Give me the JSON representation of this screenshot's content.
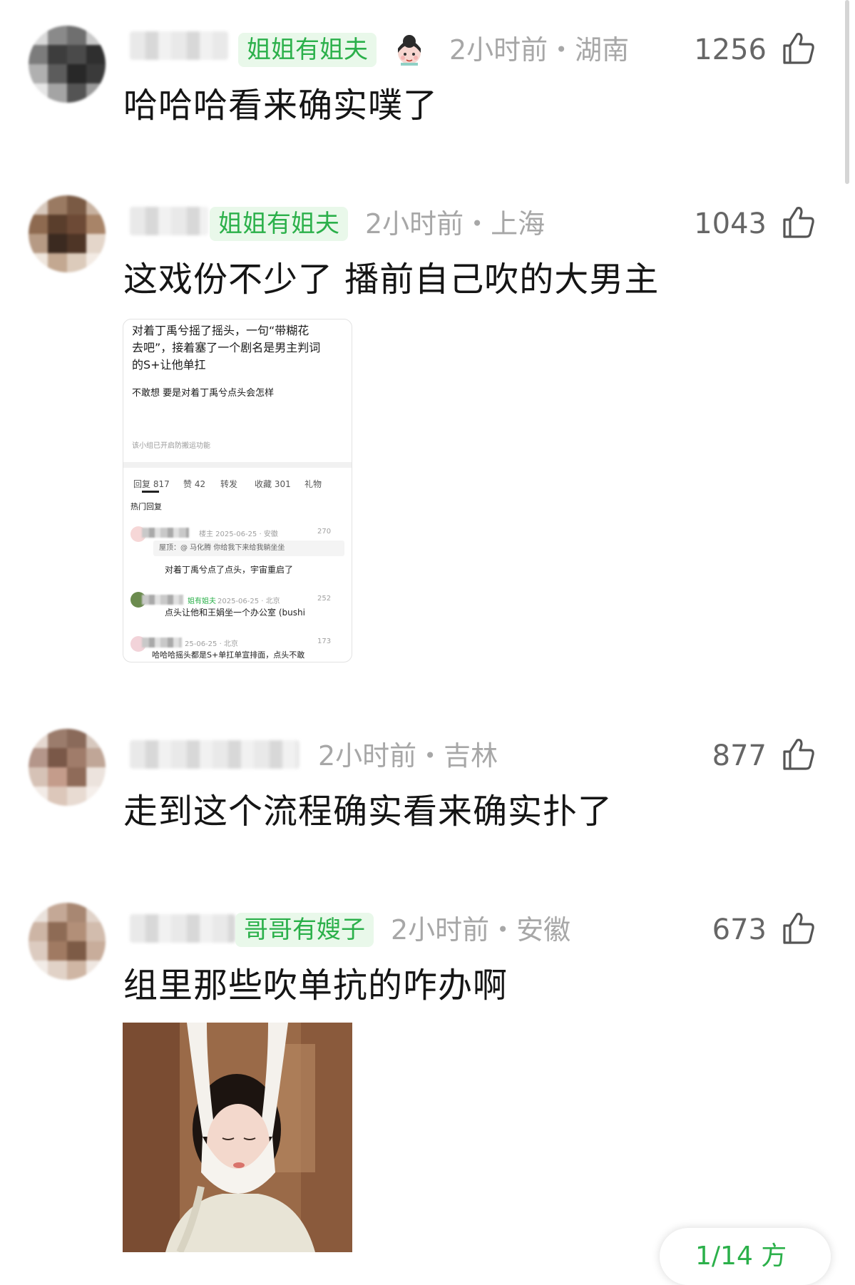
{
  "colors": {
    "badge_text": "#2bb04a",
    "badge_bg": "#e9f8ea",
    "meta_text": "#a7a7a7",
    "like_text": "#666666",
    "body_text": "#151515"
  },
  "comments": [
    {
      "badge": "姐姐有姐夫",
      "has_badge_emoji": true,
      "meta": "2小时前・湖南",
      "likes": "1256",
      "text": "哈哈哈看来确实噗了",
      "icons": [
        "like-icon"
      ]
    },
    {
      "badge": "姐姐有姐夫",
      "has_badge_emoji": false,
      "meta": "2小时前・上海",
      "likes": "1043",
      "text": "这戏份不少了 播前自己吹的大男主",
      "icons": [
        "like-icon"
      ]
    },
    {
      "badge": "",
      "has_badge_emoji": false,
      "meta": "2小时前・吉林",
      "likes": "877",
      "text": "走到这个流程确实看来确实扑了",
      "icons": [
        "like-icon"
      ]
    },
    {
      "badge": "哥哥有嫂子",
      "has_badge_emoji": false,
      "meta": "2小时前・安徽",
      "likes": "673",
      "text": "组里那些吹单抗的咋办啊",
      "icons": [
        "like-icon"
      ]
    }
  ],
  "embedded_card": {
    "post_lines": [
      "对着丁禹兮摇了摇头，一句“带糊花",
      "去吧”，接着塞了一个剧名是男主判词",
      "的S+让他单扛"
    ],
    "post_line_2": "不敢想 要是对着丁禹兮点头会怎样",
    "notice": "该小组已开启防搬运功能",
    "tabs": [
      "回复 817",
      "赞 42",
      "转发",
      "收藏 301",
      "礼物"
    ],
    "section_title": "热门回复",
    "replies": [
      {
        "meta": "楼主 2025-06-25 · 安徽",
        "likes": "270",
        "quote": "屋顶：@ 马化腾  你给我下来给我躺坐坐",
        "text": "对着丁禹兮点了点头，宇宙重启了"
      },
      {
        "badge": "姐有姐夫",
        "meta": "2025-06-25 · 北京",
        "likes": "252",
        "text": "点头让他和王娟坐一个办公室 (bushi"
      },
      {
        "meta": "25-06-25 · 北京",
        "likes": "173",
        "text": "哈哈哈摇头都是S+单扛单宣排面，点头不敢"
      }
    ]
  },
  "page_indicator": "1/14 方"
}
